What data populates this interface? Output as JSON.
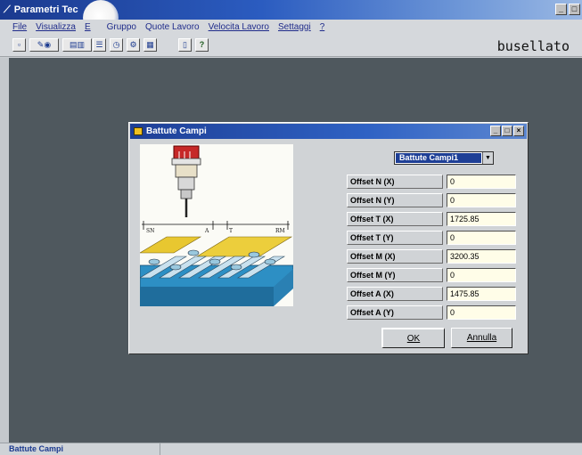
{
  "window": {
    "title": "Parametri Tec",
    "controls": [
      "_",
      "□"
    ]
  },
  "menu": {
    "items": [
      {
        "label": "File"
      },
      {
        "label": "Visualizza"
      },
      {
        "label": "E"
      },
      {
        "label": "Gruppo"
      },
      {
        "label": "Quote Lavoro"
      },
      {
        "label": "Velocita Lavoro"
      },
      {
        "label": "Settaggi"
      },
      {
        "label": "?"
      }
    ]
  },
  "toolbar": {
    "icons": [
      "new-icon",
      "tool-icon",
      "machine-icon",
      "settings-icon",
      "timer-icon",
      "gear-icon",
      "grid-icon",
      "document-icon",
      "help-icon"
    ],
    "help_glyph": "?",
    "brand": "busellato"
  },
  "dialog": {
    "title": "Battute Campi",
    "controls": [
      "_",
      "□",
      "×"
    ],
    "selector": {
      "selected": "Battute Campi1"
    },
    "diagram_labels": {
      "sn": "SN",
      "a": "A",
      "t": "T",
      "rm": "RM"
    },
    "fields": [
      {
        "label": "Offset N (X)",
        "value": "0"
      },
      {
        "label": "Offset N (Y)",
        "value": "0"
      },
      {
        "label": "Offset T (X)",
        "value": "1725.85"
      },
      {
        "label": "Offset T (Y)",
        "value": "0"
      },
      {
        "label": "Offset M (X)",
        "value": "3200.35"
      },
      {
        "label": "Offset M (Y)",
        "value": "0"
      },
      {
        "label": "Offset A (X)",
        "value": "1475.85"
      },
      {
        "label": "Offset A (Y)",
        "value": "0"
      }
    ],
    "ok_label": "OK",
    "cancel_label": "Annulla"
  },
  "statusbar": {
    "text": "Battute Campi"
  }
}
